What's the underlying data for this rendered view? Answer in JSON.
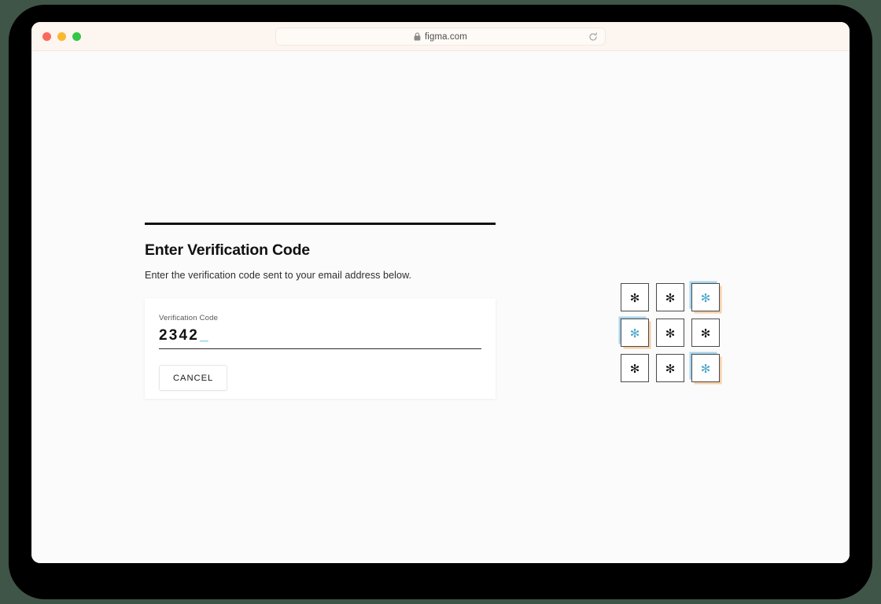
{
  "browser": {
    "traffic_lights": [
      {
        "name": "close",
        "color": "#f9695f"
      },
      {
        "name": "minimize",
        "color": "#f9b82f"
      },
      {
        "name": "maximize",
        "color": "#34c749"
      }
    ],
    "url": "figma.com",
    "lock_icon": "lock-icon",
    "reload_icon": "reload-icon"
  },
  "page": {
    "title": "Enter Verification Code",
    "subtitle": "Enter the verification code sent to your email address below.",
    "form": {
      "field_label": "Verification Code",
      "field_value": "2342",
      "cursor": "_",
      "cursor_color": "#29b6e8",
      "cancel_label": "CANCEL"
    }
  },
  "asterisk_grid": {
    "glyph": "✻",
    "rows": 3,
    "columns": 3,
    "normal_color": "#111111",
    "highlight_color": "#49a6c9",
    "glow_blue": "#a8d4ec",
    "glow_orange": "#f6cfa8",
    "cells": [
      {
        "id": "cell-r1c1",
        "highlighted": false
      },
      {
        "id": "cell-r1c2",
        "highlighted": false
      },
      {
        "id": "cell-r1c3",
        "highlighted": true
      },
      {
        "id": "cell-r2c1",
        "highlighted": true
      },
      {
        "id": "cell-r2c2",
        "highlighted": false
      },
      {
        "id": "cell-r2c3",
        "highlighted": false
      },
      {
        "id": "cell-r3c1",
        "highlighted": false
      },
      {
        "id": "cell-r3c2",
        "highlighted": false
      },
      {
        "id": "cell-r3c3",
        "highlighted": true
      }
    ]
  },
  "theme": {
    "backdrop": "#3f5547",
    "frame": "#000000",
    "titlebar": "#fdf5ef",
    "page_background": "#fbfbfb",
    "card_background": "#ffffff",
    "rule_color": "#111111"
  }
}
